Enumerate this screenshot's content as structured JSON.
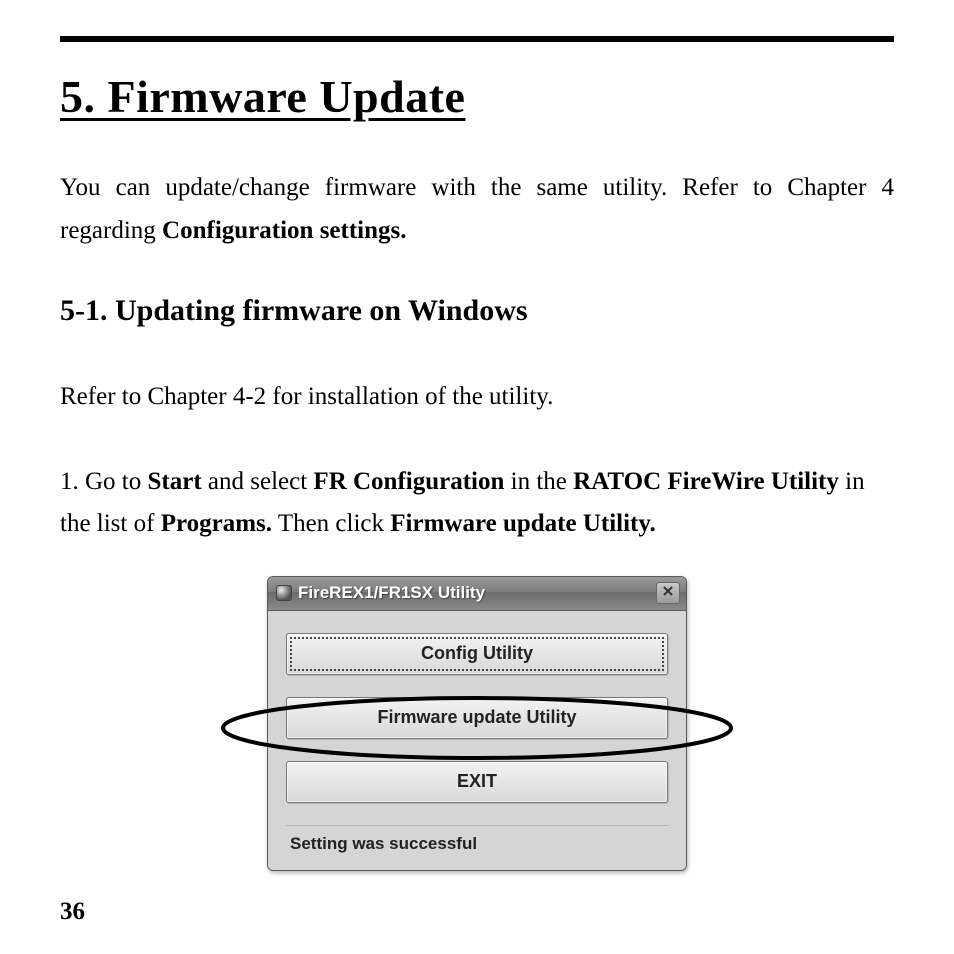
{
  "chapter_title": "5. Firmware Update",
  "intro": {
    "pre": "You can update/change firmware with the same utility. Refer to Chapter 4 regarding ",
    "bold": "Configuration settings."
  },
  "section_title": "5-1. Updating firmware on Windows",
  "refer_text": "Refer to Chapter 4-2 for installation of the utility.",
  "step1": {
    "t1": "1. Go to ",
    "b1": "Start",
    "t2": " and select ",
    "b2": "FR Configuration",
    "t3": " in the ",
    "b3": "RATOC FireWire Utility",
    "t4": " in the list of ",
    "b4": "Programs.",
    "t5": " Then click ",
    "b5": "Firmware update Utility."
  },
  "dialog": {
    "title": "FireREX1/FR1SX Utility",
    "config_btn": "Config Utility",
    "firmware_btn": "Firmware update Utility",
    "exit_btn": "EXIT",
    "status": "Setting was successful"
  },
  "page_number": "36"
}
